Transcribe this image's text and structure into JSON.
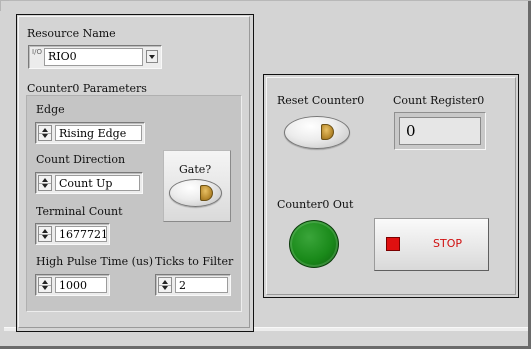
{
  "resource": {
    "label": "Resource Name",
    "value": "RIO0",
    "io_icon": "I/O"
  },
  "params": {
    "title": "Counter0 Parameters",
    "edge": {
      "label": "Edge",
      "value": "Rising Edge"
    },
    "direction": {
      "label": "Count Direction",
      "value": "Count Up"
    },
    "terminal": {
      "label": "Terminal Count",
      "value": "1677721"
    },
    "pulse": {
      "label": "High Pulse Time (us)",
      "value": "1000"
    },
    "ticks": {
      "label": "Ticks to Filter",
      "value": "2"
    },
    "gate": {
      "label": "Gate?"
    }
  },
  "right": {
    "reset_label": "Reset Counter0",
    "count_label": "Count Register0",
    "count_value": "0",
    "out_label": "Counter0 Out",
    "stop_label": "STOP"
  },
  "colors": {
    "panel": "#d4d4d4",
    "led_on": "#1a8a1a",
    "stop_red": "#e01010",
    "gold_led": "#b88a2e"
  },
  "icons": {
    "spin": "up-down-arrows",
    "dropdown": "chevron-down",
    "stop": "red-square"
  }
}
